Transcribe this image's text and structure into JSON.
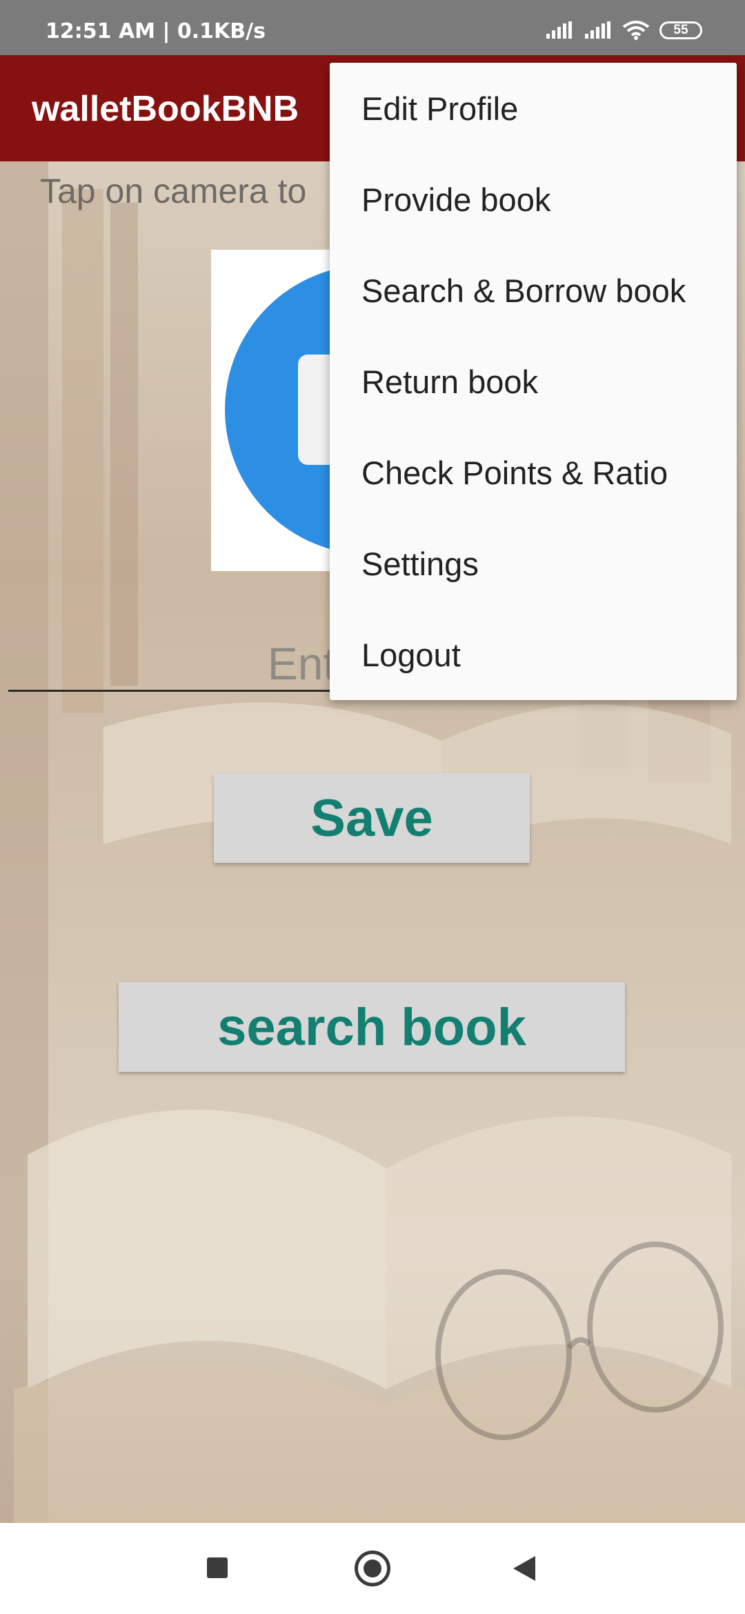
{
  "status_bar": {
    "time": "12:51 AM | 0.1KB/s",
    "battery": "55",
    "icons": [
      "signal-icon",
      "signal-icon",
      "wifi-icon",
      "battery-icon"
    ]
  },
  "app_bar": {
    "title": "walletBookBNB",
    "color": "#861111"
  },
  "main": {
    "hint": "Tap on camera to",
    "name_input_placeholder": "Enter your",
    "save_label": "Save",
    "search_label": "search book",
    "button_text_color": "#127f71"
  },
  "menu": {
    "items": [
      "Edit Profile",
      "Provide book",
      "Search & Borrow book",
      "Return book",
      "Check Points & Ratio",
      "Settings",
      "Logout"
    ]
  },
  "nav_bar": {
    "icons": [
      "recents-icon",
      "home-icon",
      "back-icon"
    ]
  }
}
